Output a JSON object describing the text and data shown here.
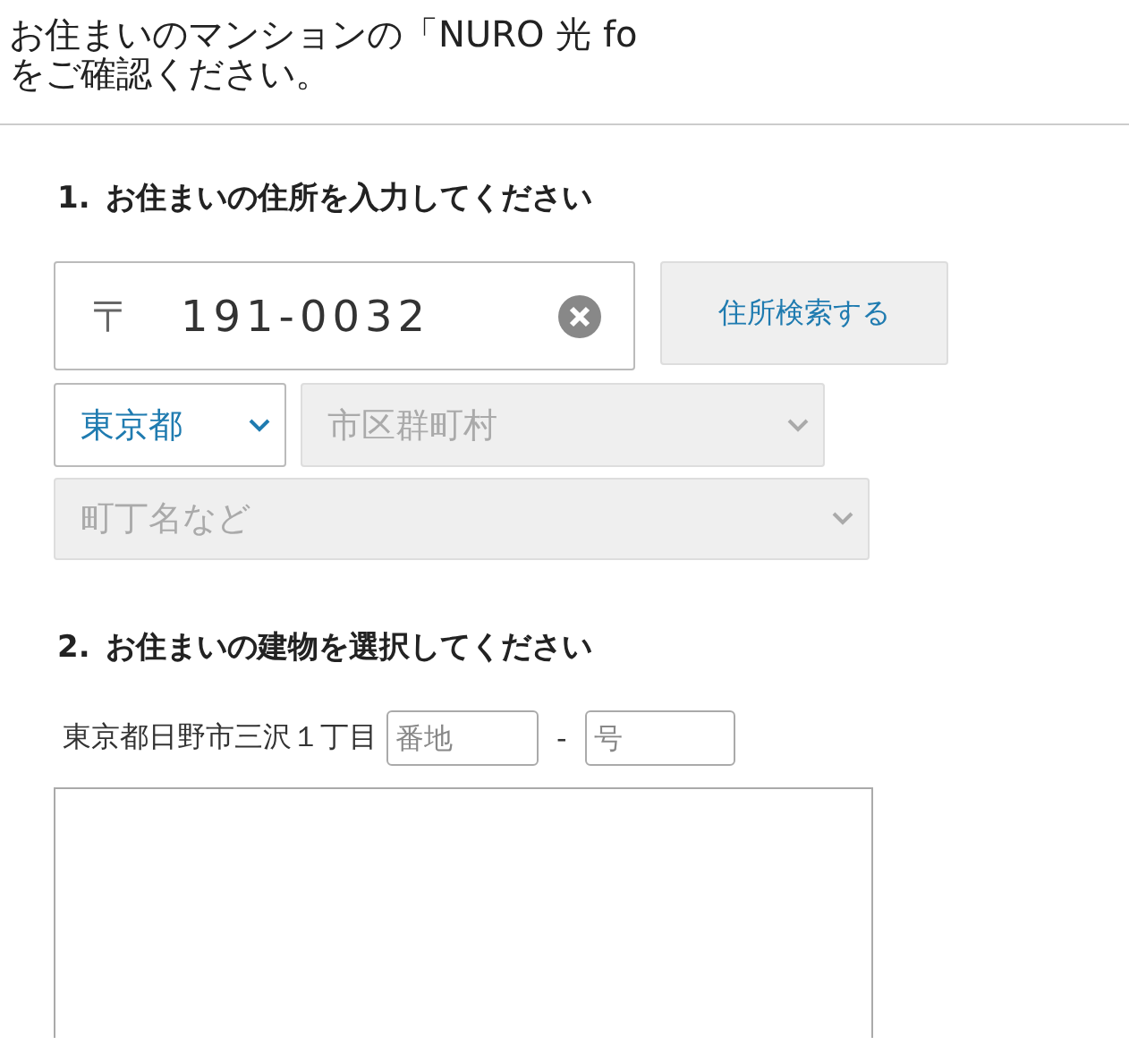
{
  "header": {
    "title_lines": [
      "お住まいのマンションの「NURO 光 fo",
      "をご確認ください。"
    ]
  },
  "step_1": {
    "number": "1.",
    "heading": "お住まいの住所を入力してください"
  },
  "postal": {
    "symbol": "〒",
    "value": "191-0032",
    "button": "住所検索する"
  },
  "selects": [
    {
      "value": "東京都",
      "disabled": false
    },
    {
      "value": "市区群町村",
      "disabled": true
    },
    {
      "value": "町丁名など",
      "disabled": true
    }
  ],
  "step_2": {
    "number": "2.",
    "heading": "お住まいの建物を選択してください"
  },
  "address": {
    "prefix": "東京都日野市三沢１丁目",
    "banchi_placeholder": "番地",
    "separator": "-",
    "go_placeholder": "号"
  }
}
